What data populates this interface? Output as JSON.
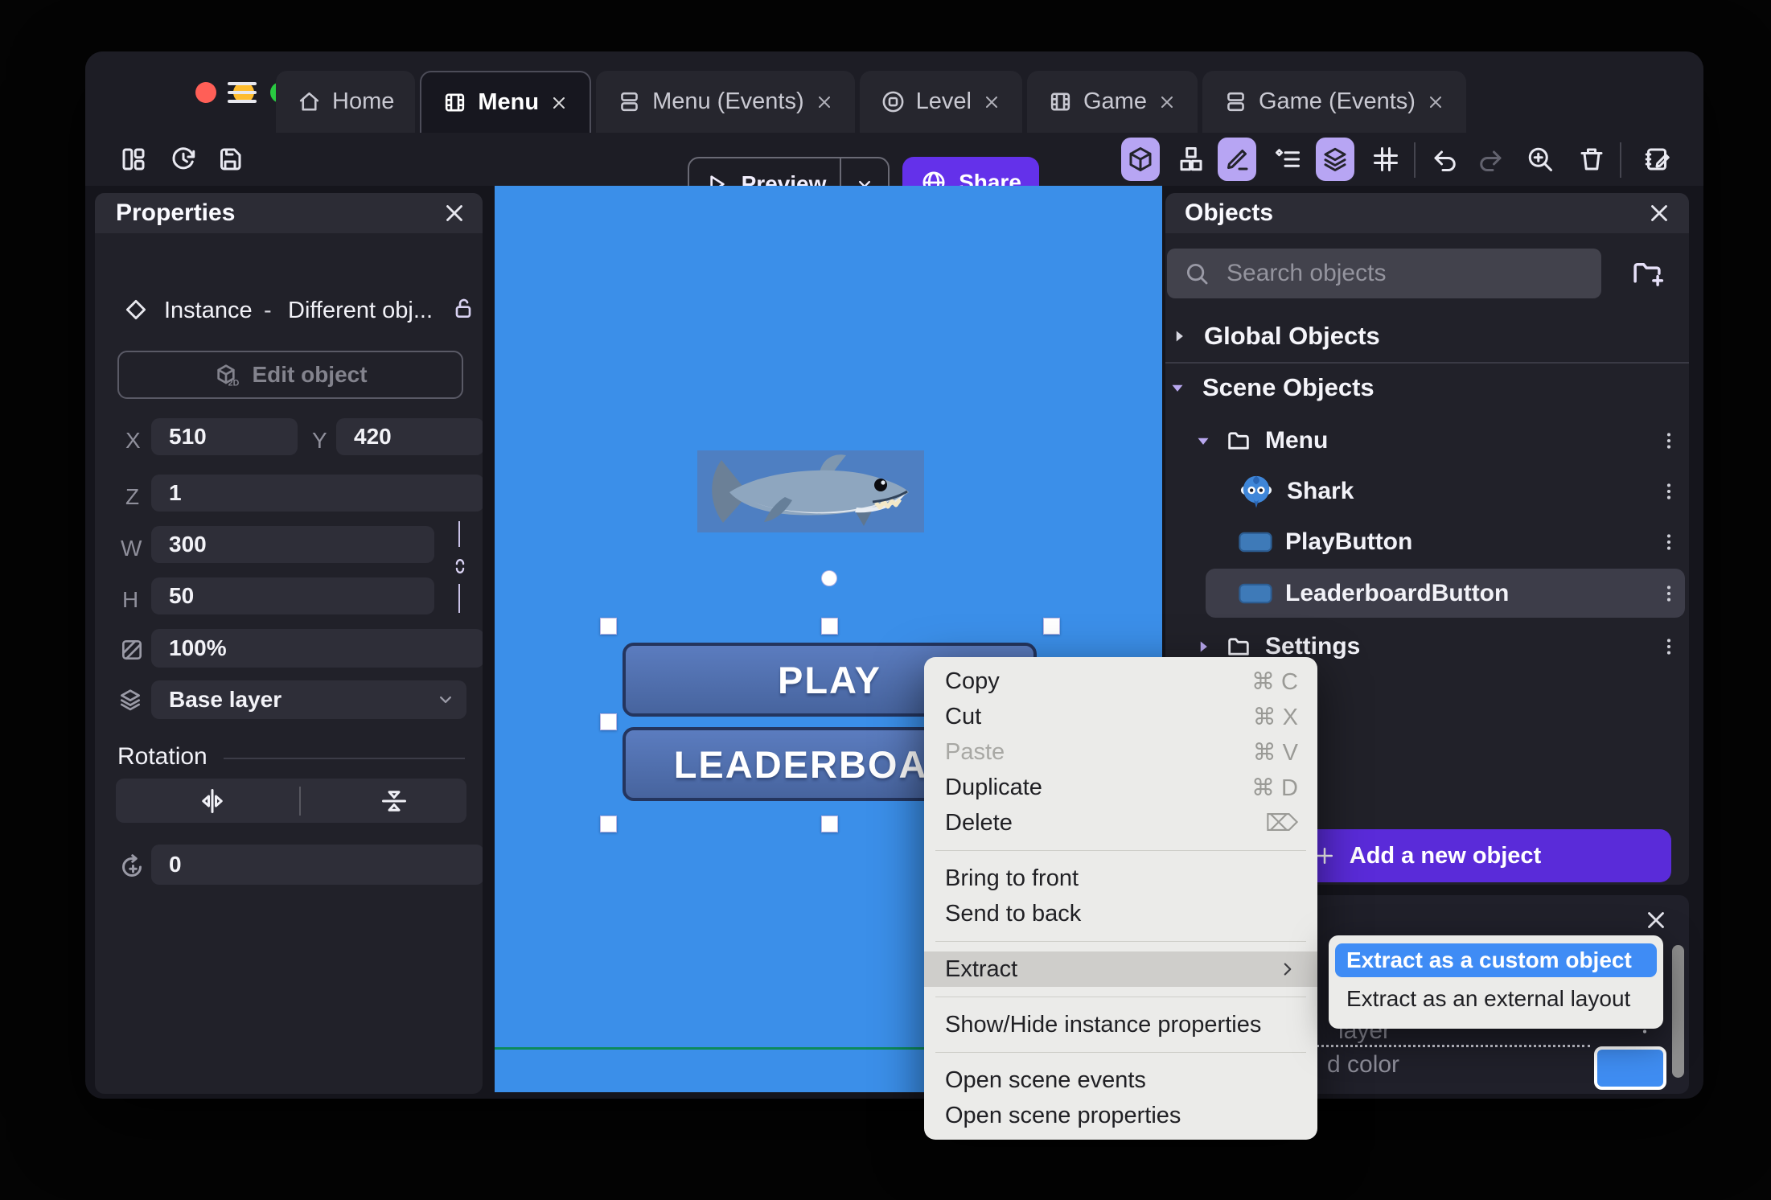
{
  "colors": {
    "share_purple": "#6431ea",
    "add_purple": "#5a2bd9",
    "active_tool_bg": "#b7a5f3",
    "canvas_blue": "#3b8fe9",
    "selection_blue": "#3f8cf5",
    "swatch_blue": "#3f8df2",
    "traffic": [
      "#ff5f57",
      "#febc2e",
      "#29c941"
    ]
  },
  "tabs": [
    {
      "label": "Home",
      "icon": "home",
      "closable": false,
      "active": false
    },
    {
      "label": "Menu",
      "icon": "scene",
      "closable": true,
      "active": true
    },
    {
      "label": "Menu (Events)",
      "icon": "events",
      "closable": true,
      "active": false
    },
    {
      "label": "Level",
      "icon": "external-layout",
      "closable": true,
      "active": false
    },
    {
      "label": "Game",
      "icon": "scene",
      "closable": true,
      "active": false
    },
    {
      "label": "Game (Events)",
      "icon": "events",
      "closable": true,
      "active": false
    }
  ],
  "toolbar": {
    "preview_label": "Preview",
    "share_label": "Share"
  },
  "properties": {
    "title": "Properties",
    "instance_type": "Instance",
    "separator": "-",
    "instance_object": "Different obj...",
    "edit_object_label": "Edit object",
    "x_label": "X",
    "x_value": "510",
    "y_label": "Y",
    "y_value": "420",
    "z_label": "Z",
    "z_value": "1",
    "w_label": "W",
    "w_value": "300",
    "h_label": "H",
    "h_value": "50",
    "opacity_value": "100%",
    "layer_value": "Base layer",
    "rotation_title": "Rotation",
    "rotation_value": "0"
  },
  "canvas": {
    "play_label": "PLAY",
    "leaderboard_label": "LEADERBOARD"
  },
  "objects": {
    "title": "Objects",
    "search_placeholder": "Search objects",
    "global_label": "Global Objects",
    "scene_label": "Scene Objects",
    "tree": [
      {
        "label": "Menu",
        "icon": "folder",
        "caret": "down",
        "indent": 1,
        "selected": false
      },
      {
        "label": "Shark",
        "icon": "shark",
        "caret": null,
        "indent": 2,
        "selected": false
      },
      {
        "label": "PlayButton",
        "icon": "button",
        "caret": null,
        "indent": 2,
        "selected": false
      },
      {
        "label": "LeaderboardButton",
        "icon": "button",
        "caret": null,
        "indent": 2,
        "selected": true
      },
      {
        "label": "Settings",
        "icon": "folder",
        "caret": "right",
        "indent": 1,
        "selected": false
      }
    ],
    "add_button_label": "Add a new object"
  },
  "context_menu": {
    "items": [
      {
        "label": "Copy",
        "shortcut": "⌘ C"
      },
      {
        "label": "Cut",
        "shortcut": "⌘ X"
      },
      {
        "label": "Paste",
        "shortcut": "⌘ V",
        "disabled": true
      },
      {
        "label": "Duplicate",
        "shortcut": "⌘ D"
      },
      {
        "label": "Delete",
        "shortcut": "⌦"
      },
      {
        "divider": true
      },
      {
        "label": "Bring to front"
      },
      {
        "label": "Send to back"
      },
      {
        "divider": true
      },
      {
        "label": "Extract",
        "submenu": true,
        "highlighted": true
      },
      {
        "divider": true
      },
      {
        "label": "Show/Hide instance properties"
      },
      {
        "divider": true
      },
      {
        "label": "Open scene events"
      },
      {
        "label": "Open scene properties"
      }
    ]
  },
  "extract_submenu": {
    "items": [
      {
        "label": "Extract as a custom object",
        "selected": true
      },
      {
        "label": "Extract as an external layout",
        "selected": false
      }
    ]
  },
  "bottom_panel": {
    "layer_fragment": "layer",
    "color_fragment": "d color"
  }
}
